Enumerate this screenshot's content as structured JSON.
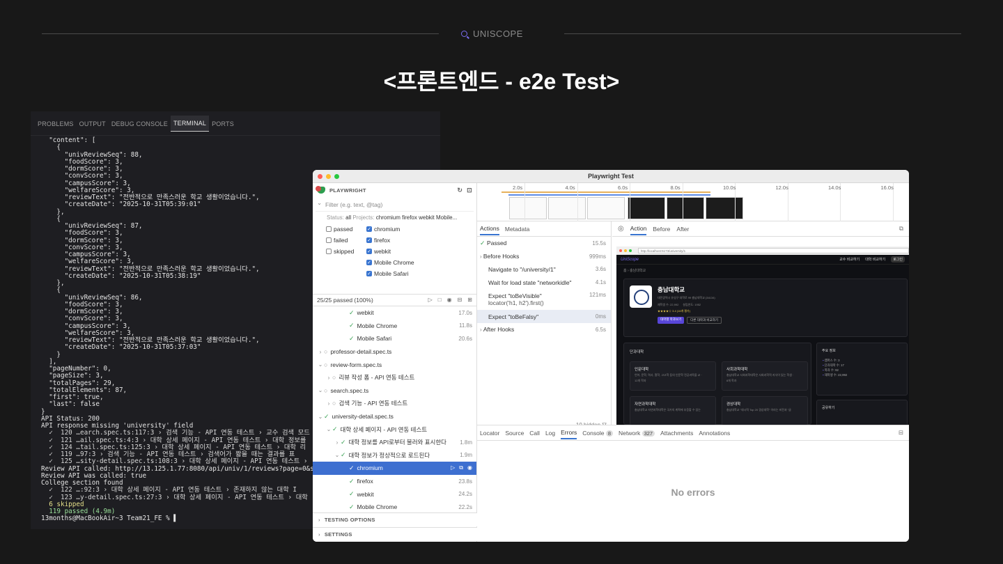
{
  "slide": {
    "brand": "UNISCOPE",
    "title": "<프론트엔드 -  e2e Test>"
  },
  "terminal": {
    "tabs": [
      "PROBLEMS",
      "OUTPUT",
      "DEBUG CONSOLE",
      "TERMINAL",
      "PORTS"
    ],
    "active_tab": "TERMINAL",
    "lines": [
      "  \"content\": [",
      "    {",
      "      \"univReviewSeq\": 88,",
      "      \"foodScore\": 3,",
      "      \"dormScore\": 3,",
      "      \"convScore\": 3,",
      "      \"campusScore\": 3,",
      "      \"welfareScore\": 3,",
      "      \"reviewText\": \"전반적으로 만족스러운 학교 생활이었습니다.\",",
      "      \"createDate\": \"2025-10-31T05:39:01\"",
      "    },",
      "    {",
      "      \"univReviewSeq\": 87,",
      "      \"foodScore\": 3,",
      "      \"dormScore\": 3,",
      "      \"convScore\": 3,",
      "      \"campusScore\": 3,",
      "      \"welfareScore\": 3,",
      "      \"reviewText\": \"전반적으로 만족스러운 학교 생활이었습니다.\",",
      "      \"createDate\": \"2025-10-31T05:38:19\"",
      "    },",
      "    {",
      "      \"univReviewSeq\": 86,",
      "      \"foodScore\": 3,",
      "      \"dormScore\": 3,",
      "      \"convScore\": 3,",
      "      \"campusScore\": 3,",
      "      \"welfareScore\": 3,",
      "      \"reviewText\": \"전반적으로 만족스러운 학교 생활이었습니다.\",",
      "      \"createDate\": \"2025-10-31T05:37:03\"",
      "    }",
      "  ],",
      "  \"pageNumber\": 0,",
      "  \"pageSize\": 3,",
      "  \"totalPages\": 29,",
      "  \"totalElements\": 87,",
      "  \"first\": true,",
      "  \"last\": false",
      "}",
      "API Status: 200",
      "API response missing 'university' field",
      "  ✓  120 …earch.spec.ts:117:3 › 검색 기능 - API 연동 테스트 › 교수 검색 모드",
      "  ✓  121 …ail.spec.ts:4:3 › 대학 상세 페이지 - API 연동 테스트 › 대학 정보를",
      "  ✓  124 …tail.spec.ts:125:3 › 대학 상세 페이지 - API 연동 테스트 › 대학 리",
      "  ✓  119 …97:3 › 검색 기능 - API 연동 테스트 › 검색어가 짧을 때는 결과를 표",
      "  ✓  125 …sity-detail.spec.ts:108:3 › 대학 상세 페이지 - API 연동 테스트 › ",
      "Review API called: http://13.125.1.77:8080/api/univ/1/reviews?page=0&size=3",
      "Review API was called: true",
      "College section found",
      "  ✓  122 …:92:3 › 대학 상세 페이지 - API 연동 테스트 › 존재하지 않는 대학 I",
      "  ✓  123 …y-detail.spec.ts:27:3 › 대학 상세 페이지 - API 연동 테스트 › 대학",
      "",
      "  6 skipped",
      "  119 passed (4.9m)",
      "13months@MacBookAir~3 Team21_FE % ▌"
    ]
  },
  "playwright": {
    "window_title": "Playwright Test",
    "brand": "PLAYWRIGHT",
    "filter_placeholder": "Filter (e.g. text, @tag)",
    "status_label": "Status:",
    "status_value": "all",
    "projects_label": "Projects:",
    "projects_value": "chromium firefox webkit Mobile...",
    "status_filters": [
      {
        "label": "passed",
        "checked": false
      },
      {
        "label": "failed",
        "checked": false
      },
      {
        "label": "skipped",
        "checked": false
      }
    ],
    "project_filters": [
      {
        "label": "chromium",
        "checked": true
      },
      {
        "label": "firefox",
        "checked": true
      },
      {
        "label": "webkit",
        "checked": true
      },
      {
        "label": "Mobile Chrome",
        "checked": true
      },
      {
        "label": "Mobile Safari",
        "checked": true
      }
    ],
    "pass_summary": "25/25 passed (100%)",
    "tree": [
      {
        "indent": 3,
        "icon": "check",
        "label": "webkit",
        "dur": "17.0s"
      },
      {
        "indent": 3,
        "icon": "check",
        "label": "Mobile Chrome",
        "dur": "11.8s"
      },
      {
        "indent": 3,
        "icon": "check",
        "label": "Mobile Safari",
        "dur": "20.6s"
      },
      {
        "indent": 0,
        "chev": "›",
        "icon": "circle",
        "label": "professor-detail.spec.ts",
        "dur": ""
      },
      {
        "indent": 0,
        "chev": "⌄",
        "icon": "circle",
        "label": "review-form.spec.ts",
        "dur": ""
      },
      {
        "indent": 1,
        "chev": "›",
        "icon": "circle",
        "label": "리뷰 작성 폼 - API 연동 테스트",
        "dur": ""
      },
      {
        "indent": 0,
        "chev": "⌄",
        "icon": "circle",
        "label": "search.spec.ts",
        "dur": ""
      },
      {
        "indent": 1,
        "chev": "›",
        "icon": "circle",
        "label": "검색 기능 - API 연동 테스트",
        "dur": ""
      },
      {
        "indent": 0,
        "chev": "⌄",
        "icon": "check",
        "label": "university-detail.spec.ts",
        "dur": ""
      },
      {
        "indent": 1,
        "chev": "⌄",
        "icon": "check",
        "label": "대학 상세 페이지 - API 연동 테스트",
        "dur": ""
      },
      {
        "indent": 2,
        "chev": "›",
        "icon": "check",
        "label": "대학 정보를 API로부터 불러와 표시한다",
        "dur": "1.8m"
      },
      {
        "indent": 2,
        "chev": "⌄",
        "icon": "check",
        "label": "대학 정보가 정상적으로 로드된다",
        "dur": "1.9m"
      },
      {
        "indent": 3,
        "icon": "check",
        "label": "chromium",
        "dur": "",
        "selected": true
      },
      {
        "indent": 3,
        "icon": "check",
        "label": "firefox",
        "dur": "23.8s"
      },
      {
        "indent": 3,
        "icon": "check",
        "label": "webkit",
        "dur": "24.2s"
      },
      {
        "indent": 3,
        "icon": "check",
        "label": "Mobile Chrome",
        "dur": "22.2s"
      },
      {
        "indent": 3,
        "icon": "check",
        "label": "Mobile Safari",
        "dur": "30.4s"
      }
    ],
    "footer_sections": [
      "TESTING OPTIONS",
      "SETTINGS"
    ],
    "timeline_ticks": [
      "2.0s",
      "4.0s",
      "6.0s",
      "8.0s",
      "10.0s",
      "12.0s",
      "14.0s",
      "16.0s"
    ],
    "action_tabs": [
      "Actions",
      "Metadata"
    ],
    "actions": [
      {
        "label": "Passed",
        "dur": "15.5s",
        "type": "passed"
      },
      {
        "label": "Before Hooks",
        "dur": "999ms",
        "type": "group"
      },
      {
        "label": "Navigate to \"/university/1\"",
        "dur": "3.6s",
        "type": "step"
      },
      {
        "label": "Wait for load state \"networkidle\"",
        "dur": "4.1s",
        "type": "step"
      },
      {
        "label": "Expect \"toBeVisible\"",
        "label2": "locator('h1, h2').first()",
        "dur": "121ms",
        "type": "step2"
      },
      {
        "label": "Expect \"toBeFalsy\"",
        "dur": "0ms",
        "type": "step",
        "selected": true
      },
      {
        "label": "After Hooks",
        "dur": "6.5s",
        "type": "group"
      }
    ],
    "hidden_count": "10 hidden",
    "preview_tabs": [
      "Action",
      "Before",
      "After"
    ],
    "bottom_tabs": [
      {
        "label": "Locator"
      },
      {
        "label": "Source"
      },
      {
        "label": "Call"
      },
      {
        "label": "Log"
      },
      {
        "label": "Errors",
        "active": true
      },
      {
        "label": "Console",
        "count": "8"
      },
      {
        "label": "Network",
        "count": "327"
      },
      {
        "label": "Attachments"
      },
      {
        "label": "Annotations"
      }
    ],
    "no_errors": "No errors",
    "site": {
      "url": "http://localhost:5173/university/1",
      "logo": "UniScope",
      "nav_links": [
        "교수 비교하기",
        "대학 비교하기",
        "로그인"
      ],
      "crumb": "홈  ›  충남대학교",
      "univ_name": "충남대학교",
      "univ_sub": "대전광역시 유성구 대학로 99 충남대학교 (34134)",
      "stats": [
        "재학생 수: 22,992",
        "설립연도: 1952"
      ],
      "rating": "★★★★☆ 3.4 (16개 평가)",
      "btn_primary": "대학별 학과보기",
      "btn_secondary": "다른 대학과 비교하기",
      "colleges_title": "단과대학",
      "colleges": [
        {
          "name": "인문대학",
          "desc": "언어, 문학, 역사, 철학, 고고학 등의 인문학 전공과목을 교 ·",
          "count": "12개 학과"
        },
        {
          "name": "사회과학대학",
          "desc": "충남대학교 사회과학대학은 사회과학적 지식이 있는 학생 ·",
          "count": "8개 학과"
        },
        {
          "name": "자연과학대학",
          "desc": "충남대학교 자연과학대학은 국가의 계획에 부응할 수 있는",
          "count": ""
        },
        {
          "name": "경상대학",
          "desc": "충남대학교 \"대시적 Top 20 경상대학\" 이라는 비전과 \"글",
          "count": ""
        }
      ],
      "info_title": "주요 정보",
      "info_items": [
        "캠퍼스 수: 3",
        "단과대학 수: 17",
        "학과 수: 92",
        "재학생 수: 22,992"
      ],
      "share_title": "공유하기"
    }
  },
  "colors": {
    "bg": "#181818",
    "accent": "#7b6cf0",
    "selected": "#3d6fd0",
    "pass": "#3ba255"
  }
}
